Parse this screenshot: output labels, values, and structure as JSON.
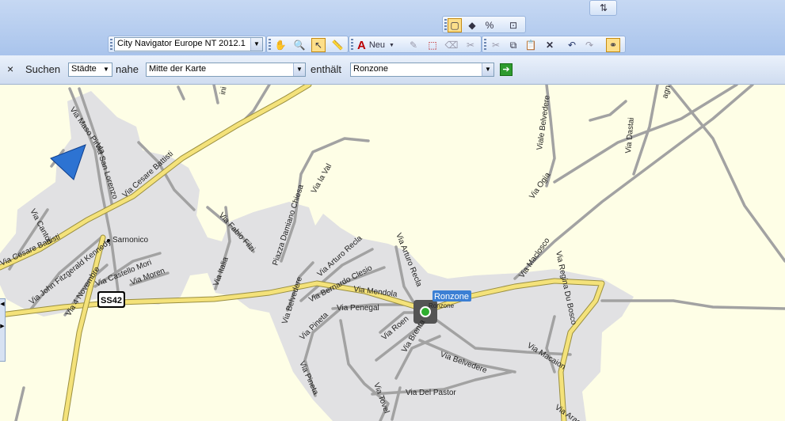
{
  "toolbar": {
    "map_product": "City Navigator Europe NT 2012.1",
    "new_label": "Neu"
  },
  "search": {
    "close": "×",
    "search_label": "Suchen",
    "type_value": "Städte",
    "near_label": "nahe",
    "near_value": "Mitte der Karte",
    "contains_label": "enthält",
    "query_value": "Ronzone"
  },
  "map": {
    "road_label": "SS42",
    "result_label": "Ronzone",
    "streets": {
      "s1": "Via Maso Pirola",
      "s2": "Via San Lorenzo",
      "s3": "Via Cesare Battisti",
      "s4": "Via Cesare Battisti",
      "s5": "Via Canton",
      "s6": "Via John Fitzgerald Kennedy",
      "s7": "Via 4 Novembre",
      "s8": "Via Castello Mori",
      "s9": "Via Moren",
      "s10": "Via Fabio Filzi",
      "s11": "Via Italia",
      "s12": "Piazza Damiano Chiesa",
      "s13": "Via la Val",
      "s14": "Via Belvedere",
      "s15": "Via Arturo Recla",
      "s16": "Via Bernardo Clesio",
      "s17": "Via Arturo Recla",
      "s18": "Via Mendola",
      "s19": "Via Penegal",
      "s20": "Via Pineta",
      "s21": "Via Roen",
      "s22": "Via Brenta",
      "s23": "Via Belvedere",
      "s24": "Via Pineta",
      "s25": "Via Tovel",
      "s26": "Via Del Pastor",
      "s27": "Via Maclosco",
      "s28": "Via Regina Du Bosco",
      "s29": "Via Macaion",
      "s30": "Via Araen",
      "s31": "Viale Belvedere",
      "s32": "Via Dastai",
      "s33": "Via Ogia",
      "s34": "Sarnonico",
      "s35": "Ronzone",
      "s36": "ini",
      "s37": "agn"
    }
  }
}
